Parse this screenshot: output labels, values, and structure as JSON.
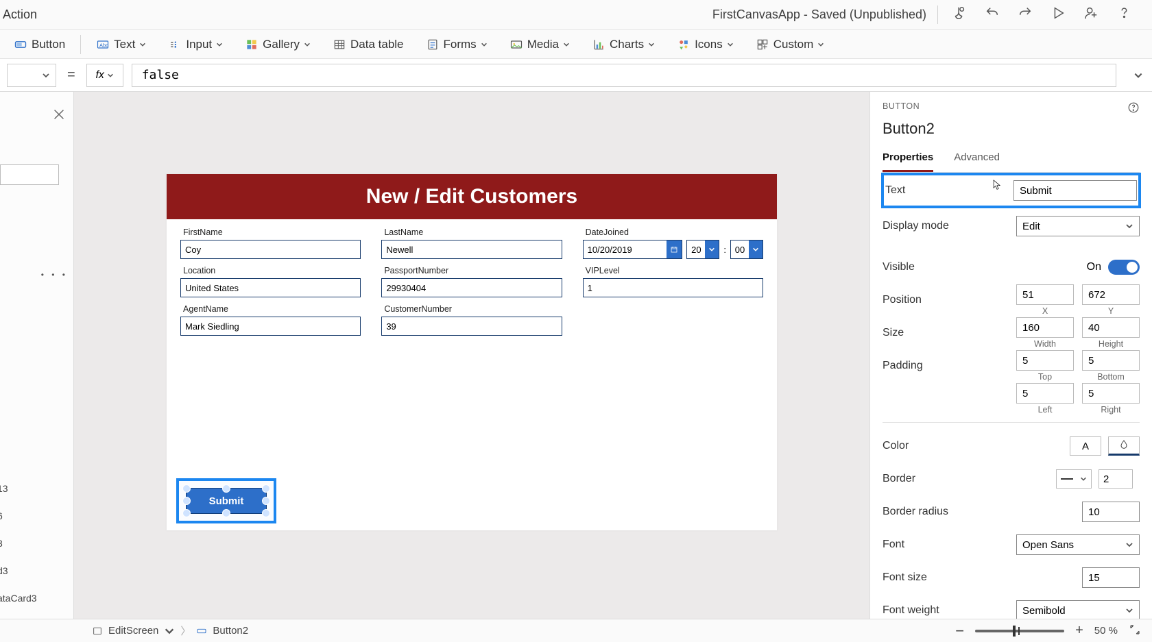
{
  "header": {
    "menu_left": "Action",
    "title": "FirstCanvasApp - Saved (Unpublished)"
  },
  "ribbon": {
    "button": "Button",
    "text": "Text",
    "input": "Input",
    "gallery": "Gallery",
    "datatable": "Data table",
    "forms": "Forms",
    "media": "Media",
    "charts": "Charts",
    "icons": "Icons",
    "custom": "Custom"
  },
  "formula": {
    "equals": "=",
    "fx": "fx",
    "code": "false"
  },
  "left_rail_cropped": [
    "13",
    "6",
    "3",
    "d3",
    "ataCard3"
  ],
  "canvas_app": {
    "title": "New / Edit Customers",
    "fields": {
      "firstname_label": "FirstName",
      "firstname_value": "Coy",
      "lastname_label": "LastName",
      "lastname_value": "Newell",
      "datejoined_label": "DateJoined",
      "datejoined_value": "10/20/2019",
      "hour_value": "20",
      "minute_value": "00",
      "location_label": "Location",
      "location_value": "United States",
      "passport_label": "PassportNumber",
      "passport_value": "29930404",
      "vip_label": "VIPLevel",
      "vip_value": "1",
      "agent_label": "AgentName",
      "agent_value": "Mark Siedling",
      "custno_label": "CustomerNumber",
      "custno_value": "39"
    },
    "submit_label": "Submit"
  },
  "properties": {
    "crumb_type": "BUTTON",
    "name": "Button2",
    "tab_props": "Properties",
    "tab_adv": "Advanced",
    "text_label": "Text",
    "text_value": "Submit",
    "display_label": "Display mode",
    "display_value": "Edit",
    "visible_label": "Visible",
    "visible_value": "On",
    "position_label": "Position",
    "pos_x": "51",
    "pos_y": "672",
    "pos_x_sub": "X",
    "pos_y_sub": "Y",
    "size_label": "Size",
    "size_w": "160",
    "size_h": "40",
    "size_w_sub": "Width",
    "size_h_sub": "Height",
    "padding_label": "Padding",
    "pad_t": "5",
    "pad_r": "5",
    "pad_l": "5",
    "pad_b": "5",
    "pad_t_sub": "Top",
    "pad_r_sub": "Right",
    "pad_l_sub": "Left",
    "pad_b_sub": "Bottom",
    "color_label": "Color",
    "color_letter": "A",
    "border_label": "Border",
    "border_width": "2",
    "borderradius_label": "Border radius",
    "borderradius_value": "10",
    "font_label": "Font",
    "font_value": "Open Sans",
    "fontsize_label": "Font size",
    "fontsize_value": "15",
    "fontweight_label": "Font weight",
    "fontweight_value": "Semibold"
  },
  "statusbar": {
    "breadcrumb1": "EditScreen",
    "breadcrumb2": "Button2",
    "zoom_value": "50",
    "zoom_unit": "%"
  }
}
